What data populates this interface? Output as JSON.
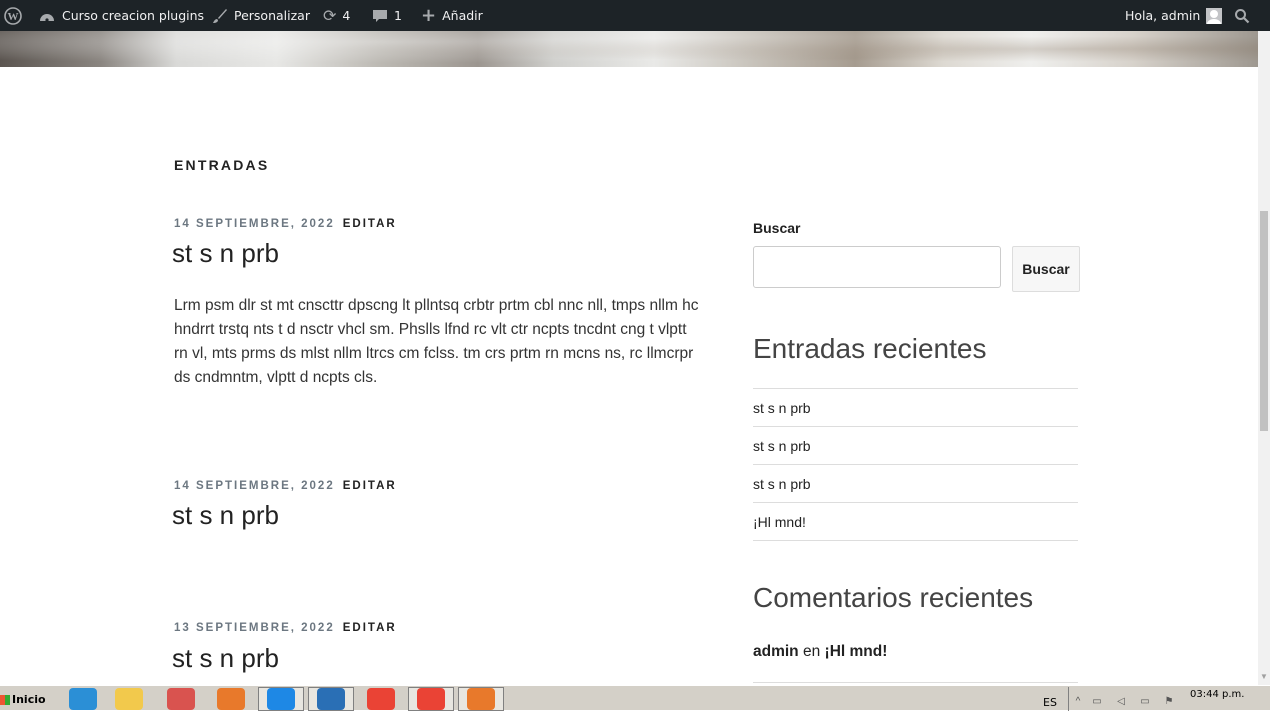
{
  "adminbar": {
    "site_name": "Curso creacion plugins",
    "customize": "Personalizar",
    "updates_count": "4",
    "comments_count": "1",
    "add_new": "Añadir",
    "greeting": "Hola, admin"
  },
  "main": {
    "section_title": "ENTRADAS",
    "posts": [
      {
        "date": "14 SEPTIEMBRE, 2022",
        "edit": "EDITAR",
        "title": "st s n prb",
        "excerpt": "Lrm psm dlr st mt cnscttr dpscng lt pllntsq crbtr prtm cbl nnc nll, tmps nllm hc hndrrt trstq nts t d nsctr vhcl sm. Phslls lfnd rc vlt ctr ncpts tncdnt cng t vlptt rn vl, mts prms ds mlst nllm ltrcs cm fclss. tm crs prtm rn mcns ns, rc llmcrpr ds cndmntm, vlptt d ncpts cls."
      },
      {
        "date": "14 SEPTIEMBRE, 2022",
        "edit": "EDITAR",
        "title": "st s n prb"
      },
      {
        "date": "13 SEPTIEMBRE, 2022",
        "edit": "EDITAR",
        "title": "st s n prb"
      }
    ]
  },
  "sidebar": {
    "search_label": "Buscar",
    "search_button": "Buscar",
    "recent_posts_title": "Entradas recientes",
    "recent_posts": [
      "st s n prb",
      "st s n prb",
      "st s n prb",
      "¡Hl mnd!"
    ],
    "recent_comments_title": "Comentarios recientes",
    "comment_author": "admin",
    "comment_on": "en",
    "comment_post": "¡Hl mnd!"
  },
  "taskbar": {
    "start_label": "Inicio",
    "language": "ES",
    "clock": "03:44 p.m.",
    "app_colors": [
      "#2b8fd6",
      "#f2c94c",
      "#d9534f",
      "#e8792b",
      "#1e88e5",
      "#2a6fb5",
      "#ea4335",
      "#ea4335",
      "#e8792b"
    ]
  }
}
